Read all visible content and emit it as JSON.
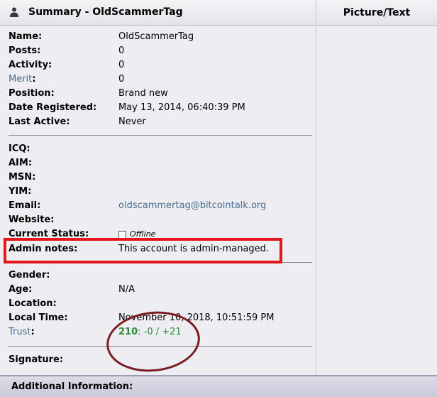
{
  "header": {
    "summary_title": "Summary - OldScammerTag",
    "picture_text": "Picture/Text"
  },
  "basic": [
    {
      "label": "Name:",
      "value": "OldScammerTag"
    },
    {
      "label": "Posts:",
      "value": "0"
    },
    {
      "label": "Activity:",
      "value": "0"
    },
    {
      "label": "Merit",
      "suffix": ":",
      "value": "0"
    },
    {
      "label": "Position:",
      "value": "Brand new"
    },
    {
      "label": "Date Registered:",
      "value": "May 13, 2014, 06:40:39 PM"
    },
    {
      "label": "Last Active:",
      "value": "Never"
    }
  ],
  "contact": {
    "icq": "ICQ:",
    "aim": "AIM:",
    "msn": "MSN:",
    "yim": "YIM:",
    "email_label": "Email:",
    "email_value": "oldscammertag@bitcointalk.org",
    "website": "Website:",
    "status_label": "Current Status:",
    "status_value": "Offline",
    "admin_label": "Admin notes:",
    "admin_value": "This account is admin-managed."
  },
  "personal": {
    "gender": "Gender:",
    "age_label": "Age:",
    "age_value": "N/A",
    "location": "Location:",
    "localtime_label": "Local Time:",
    "localtime_value": "November 10, 2018, 10:51:59 PM",
    "trust_label": "Trust",
    "trust_colon": ":",
    "trust_score": "210",
    "trust_detail": ": -0 / +21"
  },
  "signature": "Signature:",
  "footer": {
    "additional": "Additional Information:"
  }
}
